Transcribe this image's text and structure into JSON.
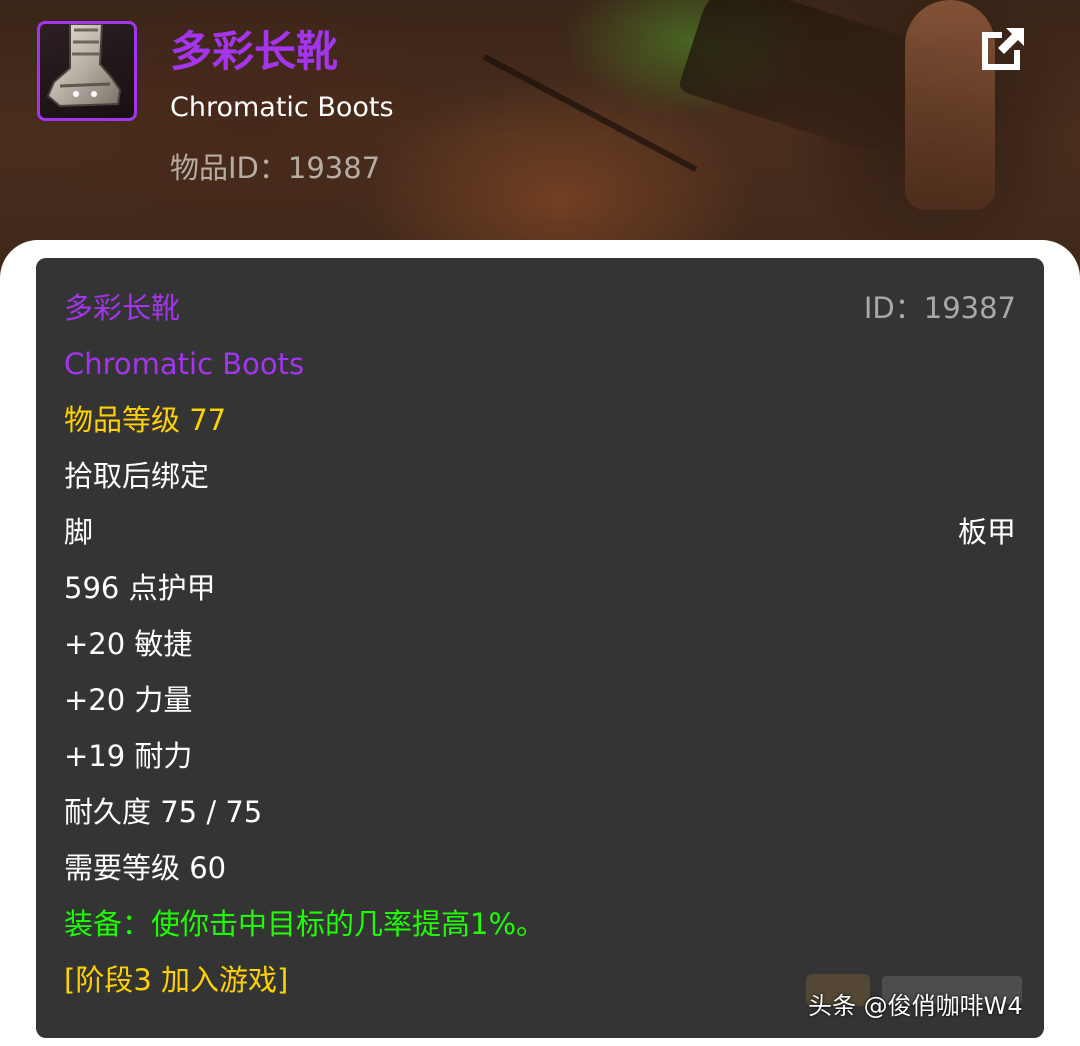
{
  "header": {
    "icon": "plate-boot-icon",
    "title_cn": "多彩长靴",
    "title_en": "Chromatic Boots",
    "id_label": "物品ID：",
    "id_value": "19387",
    "external_link_icon": "external-link-icon"
  },
  "tooltip": {
    "name_cn": "多彩长靴",
    "id_text": "ID：19387",
    "name_en": "Chromatic Boots",
    "item_level": "物品等级 77",
    "binding": "拾取后绑定",
    "slot": "脚",
    "armor_type": "板甲",
    "armor": "596 点护甲",
    "stat_agility": "+20 敏捷",
    "stat_strength": "+20 力量",
    "stat_stamina": "+19 耐力",
    "durability": "耐久度 75 / 75",
    "required_level": "需要等级 60",
    "equip_effect": "装备：使你击中目标的几率提高1%。",
    "phase": "[阶段3 加入游戏]"
  },
  "watermark": {
    "source": "头条 @俊俏咖啡W4"
  },
  "colors": {
    "epic_purple": "#a335ee",
    "gold": "#ffd100",
    "green": "#1eff00",
    "tooltip_bg": "#343434",
    "gray": "#a8a8a8"
  }
}
